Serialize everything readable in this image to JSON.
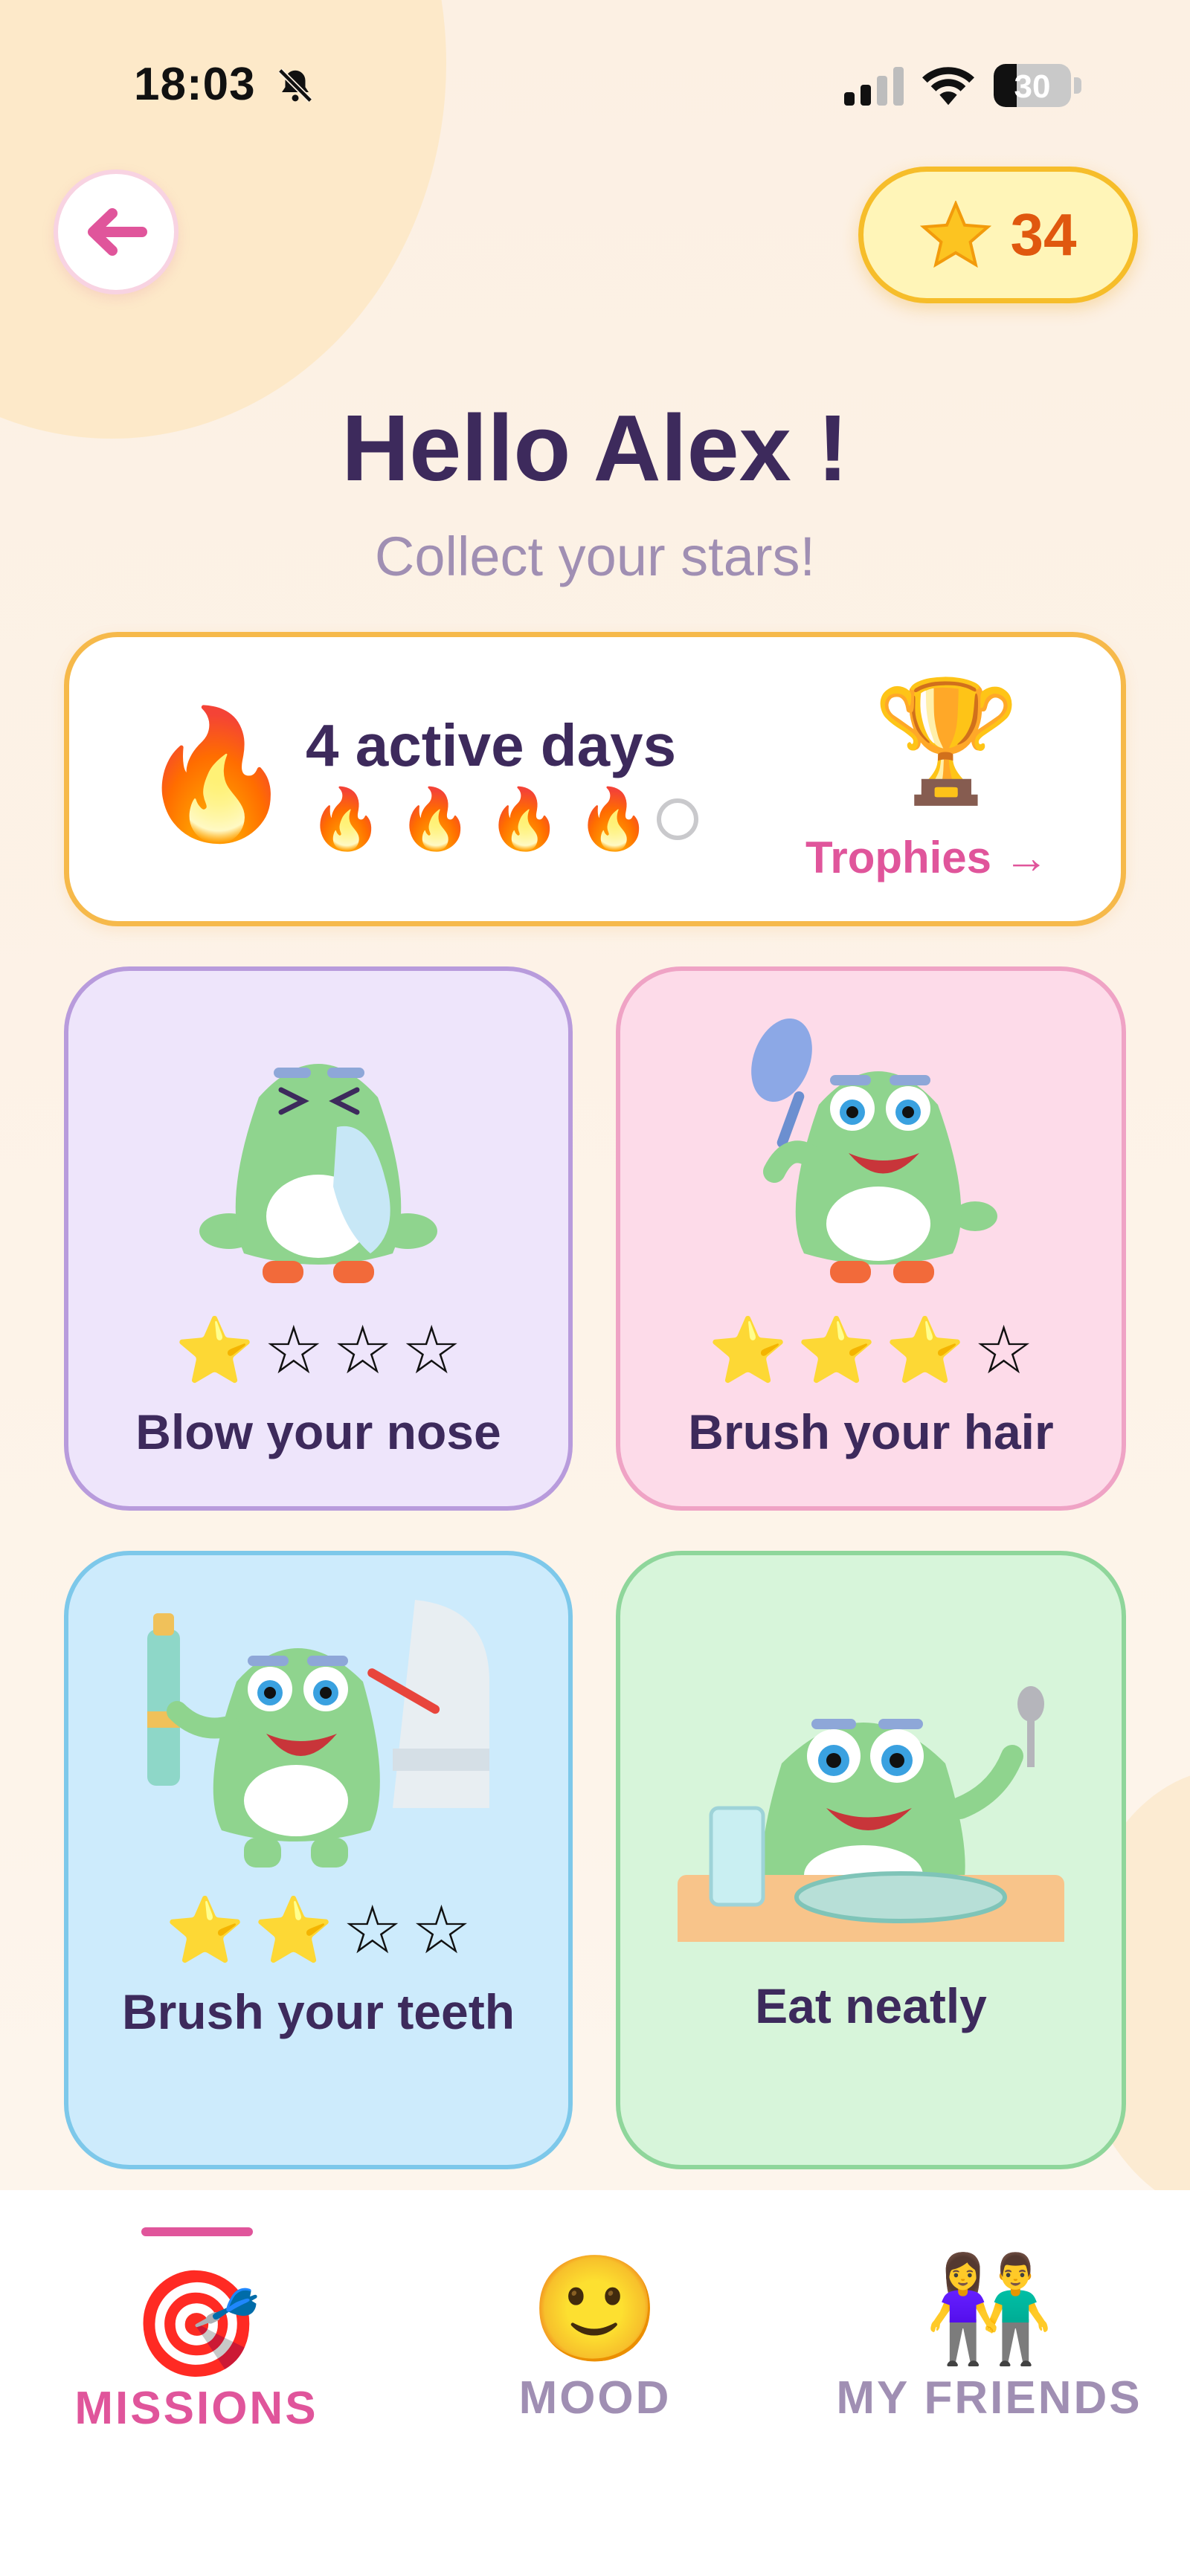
{
  "status_bar": {
    "time": "18:03",
    "battery": "30",
    "battery_level": 0.3
  },
  "header": {
    "back_icon": "arrow-left-icon",
    "star_icon": "star-icon",
    "star_count": "34"
  },
  "greeting": {
    "title": "Hello Alex !",
    "subtitle": "Collect your stars!"
  },
  "streak": {
    "title": "4 active days",
    "active_days": 4,
    "total_days": 5,
    "trophies_link": "Trophies →"
  },
  "missions": [
    {
      "label": "Blow your nose",
      "stars": 1,
      "max_stars": 4,
      "bg": "#eee5fb"
    },
    {
      "label": "Brush your hair",
      "stars": 3,
      "max_stars": 4,
      "bg": "#fddbe9"
    },
    {
      "label": "Brush your teeth",
      "stars": 2,
      "max_stars": 4,
      "bg": "#cdebfc"
    },
    {
      "label": "Eat neatly",
      "stars": 0,
      "max_stars": 0,
      "bg": "#d7f5da"
    }
  ],
  "nav": {
    "items": [
      {
        "label": "MISSIONS",
        "icon": "target-icon",
        "active": true,
        "color": "#e0559b"
      },
      {
        "label": "MOOD",
        "icon": "smiley-icon",
        "active": false,
        "color": "#a08fb3"
      },
      {
        "label": "MY FRIENDS",
        "icon": "friends-icon",
        "active": false,
        "color": "#a08fb3"
      }
    ]
  },
  "colors": {
    "accent": "#e0559b",
    "title": "#3d2a5c",
    "gold": "#f6bd2a",
    "muted": "#a08fb3"
  }
}
